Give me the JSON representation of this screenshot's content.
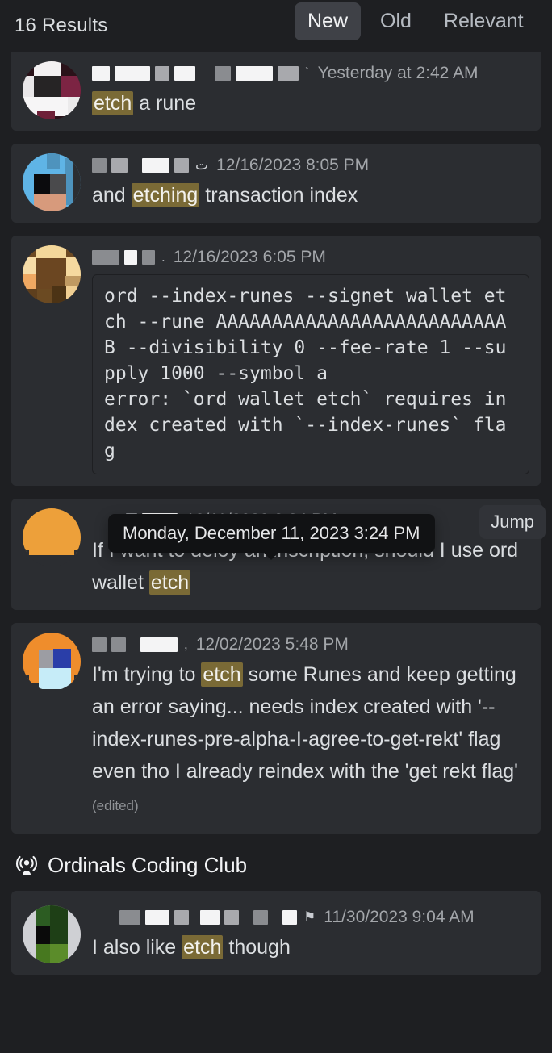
{
  "header": {
    "results_count": "16 Results",
    "sort_tabs": [
      {
        "label": "New",
        "active": true
      },
      {
        "label": "Old",
        "active": false
      },
      {
        "label": "Relevant",
        "active": false
      }
    ]
  },
  "tooltip": {
    "text": "Monday, December 11, 2023 3:24 PM"
  },
  "jump_button": {
    "label": "Jump"
  },
  "group": {
    "icon": "megaphone-icon",
    "title": "Ordinals Coding Club"
  },
  "results": [
    {
      "id": "result-1",
      "author_redacted": true,
      "timestamp": "Yesterday at 2:42 AM",
      "text_before": "",
      "highlight": "etch",
      "text_after": " a rune",
      "edited": ""
    },
    {
      "id": "result-2",
      "author_redacted": true,
      "timestamp": "12/16/2023 8:05 PM",
      "text_before": "and ",
      "highlight": "etching",
      "text_after": " transaction index",
      "edited": ""
    },
    {
      "id": "result-3",
      "author_redacted": true,
      "timestamp": "12/16/2023 6:05 PM",
      "code": "ord --index-runes --signet wallet etch --rune AAAAAAAAAAAAAAAAAAAAAAAAAAB --divisibility 0 --fee-rate 1 --supply 1000 --symbol a\nerror: `ord wallet etch` requires index created with `--index-runes` flag"
    },
    {
      "id": "result-4",
      "author_redacted": true,
      "timestamp": "12/11/2023 3:24 PM",
      "text_before": "If I want to deloy an inscription, should I use ord wallet ",
      "highlight": "etch",
      "text_after": "",
      "edited": ""
    },
    {
      "id": "result-5",
      "author_redacted": true,
      "timestamp": "12/02/2023 5:48 PM",
      "text_before": "I'm trying to ",
      "highlight": "etch",
      "text_after": " some Runes and keep getting an error saying... needs index created with '--index-runes-pre-alpha-I-agree-to-get-rekt' flag even tho I already reindex with the 'get rekt flag'",
      "edited": "(edited)"
    },
    {
      "id": "result-6",
      "author_redacted": true,
      "timestamp": "11/30/2023 9:04 AM",
      "text_before": "I also like ",
      "highlight": "etch",
      "text_after": " though",
      "edited": ""
    }
  ],
  "colors": {
    "panel_bg": "#1e1f22",
    "card_bg": "#2b2d31",
    "text": "#dbdee1",
    "muted": "#a3a6aa",
    "highlight_bg": "#7a6a36",
    "active_tab_bg": "#3f4147",
    "tooltip_bg": "#111214"
  }
}
